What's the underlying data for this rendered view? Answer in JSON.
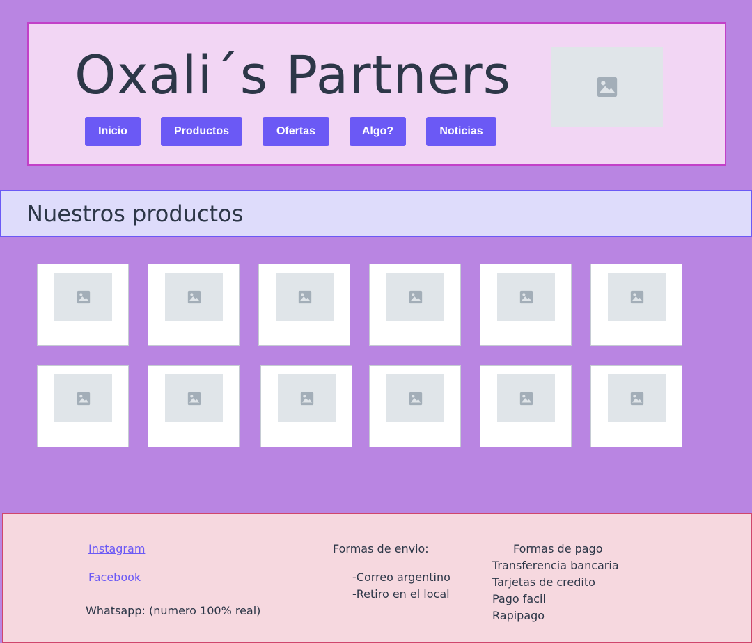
{
  "header": {
    "brand": "Oxali´s Partners",
    "logo_icon": "image-placeholder-icon",
    "nav": [
      {
        "label": "Inicio"
      },
      {
        "label": "Productos"
      },
      {
        "label": "Ofertas"
      },
      {
        "label": "Algo?"
      },
      {
        "label": "Noticias"
      }
    ]
  },
  "section": {
    "title": "Nuestros productos"
  },
  "products": {
    "thumb_icon": "image-placeholder-icon",
    "count": 12
  },
  "footer": {
    "social": {
      "instagram": "Instagram",
      "facebook": "Facebook",
      "whatsapp": "Whatsapp: (numero 100% real)"
    },
    "shipping": {
      "title": "Formas de envio:",
      "items": [
        "-Correo argentino",
        "-Retiro en el local"
      ]
    },
    "payment": {
      "title": "Formas de pago",
      "items": [
        "Transferencia bancaria",
        "Tarjetas de credito",
        "Pago facil",
        "Rapipago"
      ]
    }
  },
  "colors": {
    "page_bg": "#b985e2",
    "header_bg": "#f2d6f4",
    "accent": "#6b59f5",
    "section_bg": "#dedcfb",
    "footer_bg": "#f6d8df"
  }
}
